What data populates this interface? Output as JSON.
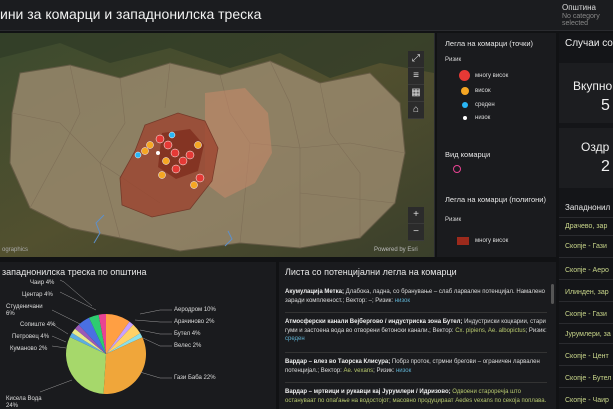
{
  "header": {
    "title": "ини за комарци и западнонилска треска",
    "municipality_label": "Општина",
    "municipality_sub": "No category selected"
  },
  "map": {
    "attribution": "ographics",
    "powered_by": "Powered by Esri",
    "zoom_in": "+",
    "zoom_out": "−"
  },
  "legend": {
    "section1_title": "Легла на комарци (точки)",
    "section1_field": "Ризик",
    "section1_items": [
      "многу висок",
      "висок",
      "среден",
      "низок"
    ],
    "section2_title": "Вид комарци",
    "section3_title": "Легла на комарци (полигони)",
    "section3_field": "Ризик",
    "section3_items": [
      "многу висок"
    ]
  },
  "right": {
    "cases_title": "Случаи со",
    "total_label": "Вкупно",
    "total_value": "5",
    "recovered_label": "Оздр",
    "recovered_value": "2",
    "list_title": "Западнонил",
    "rows": [
      "Драчево, зар",
      "Скопје - Гази",
      "Скопје - Аеро",
      "Илинден, зар",
      "Скопје - Гази",
      "Јурумлери, за",
      "Скопје - Цент",
      "Скопје - Бутел",
      "Скопје - Чаир"
    ]
  },
  "pie": {
    "title": "западнонилска треска по општина",
    "labels": [
      "Чаир 4%",
      "Центар 4%",
      "Студеничани 6%",
      "Сопиште 4%",
      "Петровец 4%",
      "Куманово 2%",
      "Кисела Вода 24%",
      "Аеродром 10%",
      "Арачиново 2%",
      "Бутел 4%",
      "Велес 2%",
      "Гази Баба 22%"
    ],
    "colors": {
      "aerodrom": "#ff9f43",
      "arachinovo": "#c7a0ff",
      "butel": "#ffd166",
      "veles": "#8be0e9",
      "gazi_baba": "#f0a63a",
      "kisela_voda": "#a6d86b",
      "kumanovo": "#5dade2",
      "petrovec": "#e9e98a",
      "sopiste": "#9b59b6",
      "studenichani": "#4a6fe3",
      "centar": "#2ecc71",
      "chair": "#e84393"
    }
  },
  "list": {
    "title": "Листа со потенцијални легла на комарци",
    "entries": [
      {
        "head": "Акумулација Метка;",
        "body": "Длабока, ладна, со бранување – слаб ларвален потенцијал. Намалено заради комплекност.; Вектор: –; Ризик:",
        "risk": "низок"
      },
      {
        "head": "Атмосферски канали Вејбергово / индустриска зона Бутел;",
        "body": "Индустриски коцкарии, стари гуми и застоена вода во отворени бетонски канали.; Вектор:",
        "vector": "Cx. pipiens, Ae. albopictus",
        "risk_label": "; Ризик:",
        "risk": "среден"
      },
      {
        "head": "Вардар – влез во Таорска Клисура;",
        "body": "Побрз проток, стрмни брегови – ограничен ларвален потенцијал.; Вектор:",
        "vector": "Ae. vexans",
        "risk_label": "; Ризик:",
        "risk": "низок"
      },
      {
        "head": "Вардар – мртвици и рукавци кај Јурумлери / Идризово;",
        "body": "Одвоени староречја што остануваат по опаѓање на водостојот; масовно продуцираат Aedes vexans по секоја поплава."
      }
    ]
  }
}
